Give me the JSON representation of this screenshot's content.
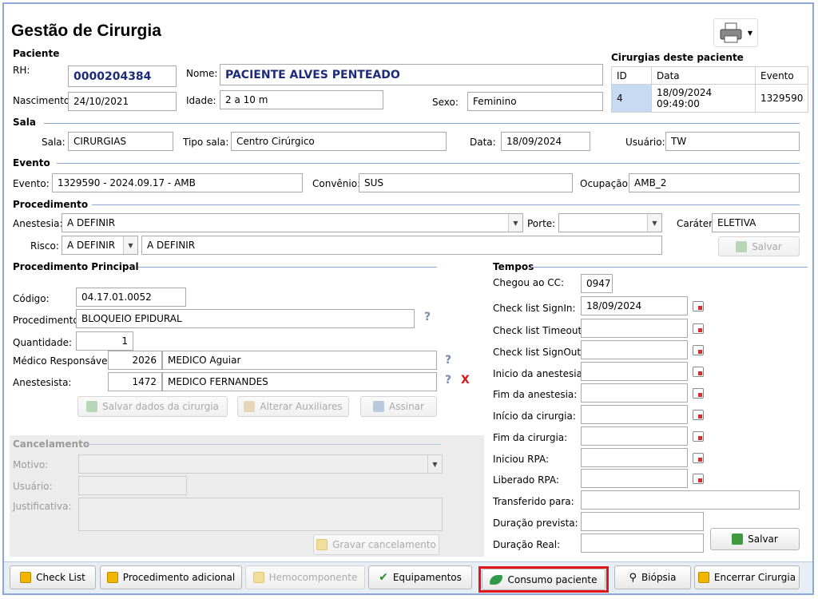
{
  "title": "Gestão de Cirurgia",
  "paciente": {
    "section": "Paciente",
    "rh_label": "RH:",
    "rh": "0000204384",
    "nome_label": "Nome:",
    "nome": "PACIENTE ALVES PENTEADO",
    "nasc_label": "Nascimento:",
    "nasc": "24/10/2021",
    "idade_label": "Idade:",
    "idade": "2 a 10 m",
    "sexo_label": "Sexo:",
    "sexo": "Feminino"
  },
  "historico": {
    "title": "Cirurgias deste paciente",
    "headers": [
      "ID",
      "Data",
      "Evento"
    ],
    "rows": [
      [
        "4",
        "18/09/2024 09:49:00",
        "1329590"
      ]
    ]
  },
  "sala": {
    "section": "Sala",
    "sala_label": "Sala:",
    "sala": "CIRURGIAS",
    "tipo_label": "Tipo sala:",
    "tipo": "Centro Cirúrgico",
    "data_label": "Data:",
    "data": "18/09/2024",
    "usuario_label": "Usuário:",
    "usuario": "TW"
  },
  "evento": {
    "section": "Evento",
    "evento_label": "Evento:",
    "evento": "1329590 - 2024.09.17 - AMB",
    "convenio_label": "Convênio:",
    "convenio": "SUS",
    "ocupacao_label": "Ocupação:",
    "ocupacao": "AMB_2"
  },
  "procedimento": {
    "section": "Procedimento",
    "anestesia_label": "Anestesia:",
    "anestesia": "A DEFINIR",
    "porte_label": "Porte:",
    "porte": "",
    "carater_label": "Caráter:",
    "carater": "ELETIVA",
    "risco_label": "Risco:",
    "risco": "A DEFINIR",
    "risco_desc": "A DEFINIR",
    "salvar": "Salvar"
  },
  "principal": {
    "section": "Procedimento Principal",
    "codigo_label": "Código:",
    "codigo": "04.17.01.0052",
    "proc_label": "Procedimento:",
    "proc": "BLOQUEIO EPIDURAL",
    "qtd_label": "Quantidade:",
    "qtd": "1",
    "medico_label": "Médico Responsável:",
    "medico_cod": "2026",
    "medico": "MEDICO Aguiar",
    "anest_label": "Anestesista:",
    "anest_cod": "1472",
    "anest": "MEDICO FERNANDES",
    "q": "?",
    "x": "X",
    "btn_salvar": "Salvar dados da cirurgia",
    "btn_aux": "Alterar Auxiliares",
    "btn_assinar": "Assinar"
  },
  "cancelamento": {
    "section": "Cancelamento",
    "motivo_label": "Motivo:",
    "usuario_label": "Usuário:",
    "just_label": "Justificativa:",
    "btn": "Gravar cancelamento"
  },
  "tempos": {
    "section": "Tempos",
    "chegou_label": "Chegou ao CC:",
    "chegou": "0947",
    "signin_label": "Check list SignIn:",
    "signin": "18/09/2024",
    "timeout_label": "Check list Timeout:",
    "signout_label": "Check list SignOut:",
    "ini_anest_label": "Inicio da anestesia:",
    "fim_anest_label": "Fim da anestesia:",
    "ini_cir_label": "Início da cirurgia:",
    "fim_cir_label": "Fim da cirurgia:",
    "ini_rpa_label": "Iniciou RPA:",
    "lib_rpa_label": "Liberado RPA:",
    "transf_label": "Transferido para:",
    "dur_prev_label": "Duração prevista:",
    "dur_real_label": "Duração Real:",
    "salvar": "Salvar"
  },
  "bottom": {
    "checklist": "Check List",
    "proc_adic": "Procedimento adicional",
    "hemo": "Hemocomponente",
    "equip": "Equipamentos",
    "consumo": "Consumo paciente",
    "biopsia": "Biópsia",
    "encerrar": "Encerrar Cirurgia"
  }
}
